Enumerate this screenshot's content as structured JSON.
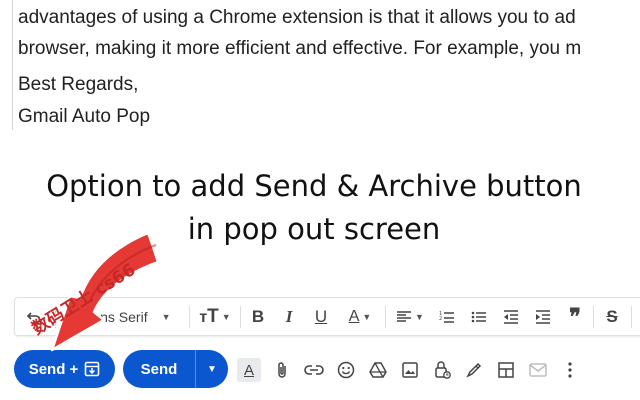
{
  "email": {
    "lines": [
      "advantages of using a Chrome extension is that it allows you to ad",
      "browser, making it more efficient and effective. For example, you m",
      "Best Regards,",
      "Gmail Auto Pop"
    ]
  },
  "caption": {
    "line1": "Option to add Send & Archive button",
    "line2": "in pop out screen"
  },
  "toolbar": {
    "font_label": "Sans Serif",
    "icons": [
      "undo-icon",
      "font-size-icon",
      "bold-icon",
      "italic-icon",
      "underline-icon",
      "text-color-icon",
      "align-icon",
      "numbered-list-icon",
      "bulleted-list-icon",
      "indent-less-icon",
      "indent-more-icon",
      "quote-icon",
      "strikethrough-icon"
    ]
  },
  "actions": {
    "send_archive_label": "Send +",
    "send_label": "Send",
    "icons": [
      "formatting-options-icon",
      "attach-icon",
      "link-icon",
      "emoji-icon",
      "drive-icon",
      "photo-icon",
      "confidential-mode-icon",
      "signature-icon",
      "layouts-icon",
      "schedule-icon",
      "more-options-icon"
    ]
  },
  "watermark": "数码卫士 cs66",
  "colors": {
    "send_blue": "#0b57d0",
    "arrow_red": "#e53935",
    "text": "#202124"
  }
}
